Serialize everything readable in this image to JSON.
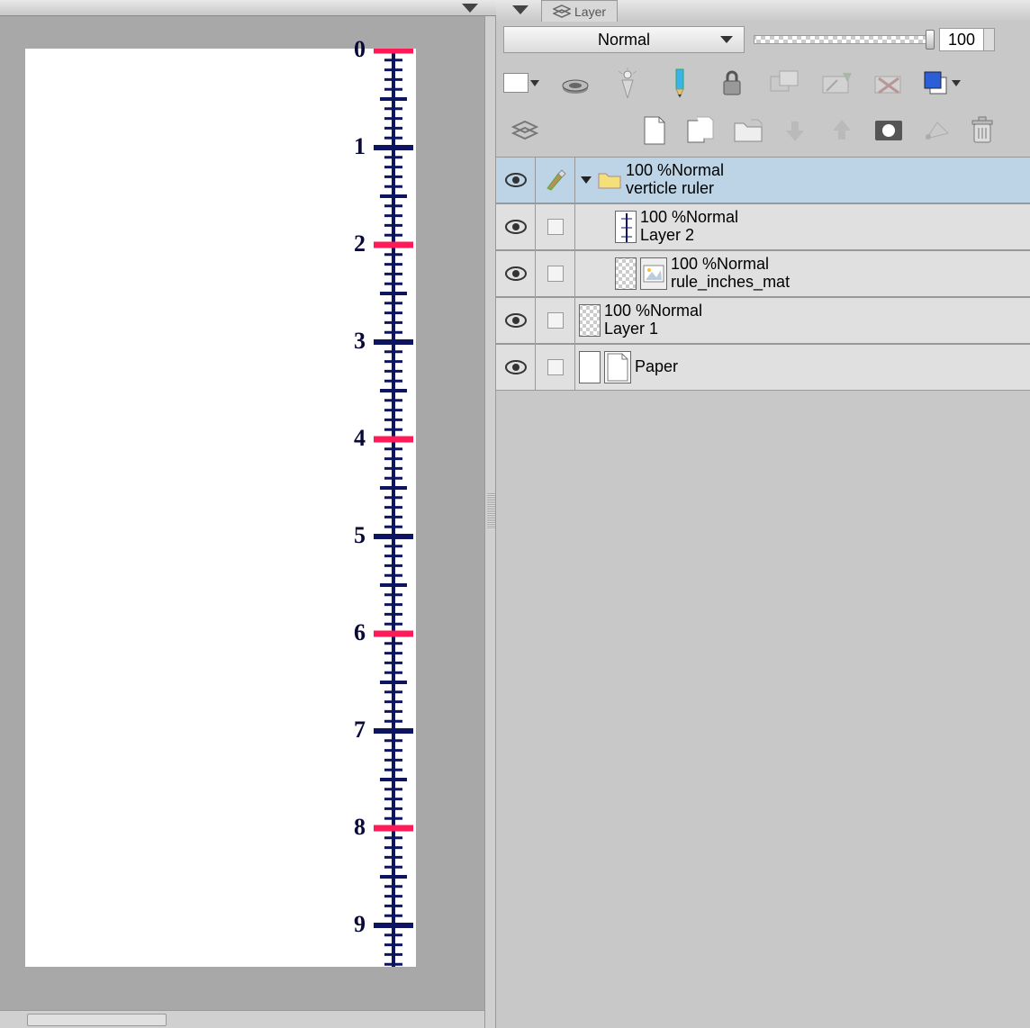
{
  "dock": {
    "tab_label": "Layer"
  },
  "blend": {
    "mode": "Normal",
    "opacity_value": "100"
  },
  "layers": [
    {
      "opacity": "100 %",
      "mode": "Normal",
      "name": "verticle ruler"
    },
    {
      "opacity": "100 %",
      "mode": "Normal",
      "name": "Layer 2"
    },
    {
      "opacity": "100 %",
      "mode": "Normal",
      "name": "rule_inches_mat"
    },
    {
      "opacity": "100 %",
      "mode": "Normal",
      "name": "Layer 1"
    },
    {
      "opacity": "",
      "mode": "",
      "name": "Paper"
    }
  ],
  "ruler": {
    "labels": [
      "0",
      "1",
      "2",
      "3",
      "4",
      "5",
      "6",
      "7",
      "8",
      "9"
    ]
  }
}
